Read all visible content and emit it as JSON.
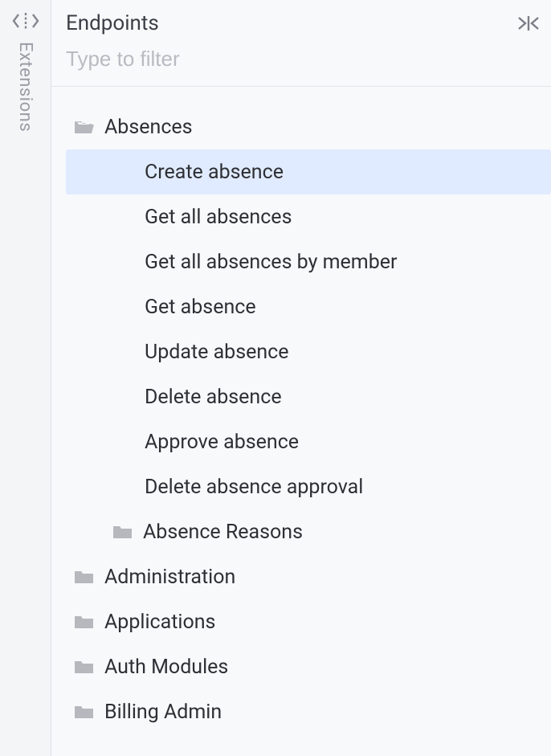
{
  "rail": {
    "label": "Extensions"
  },
  "panel": {
    "title": "Endpoints",
    "filter_placeholder": "Type to filter"
  },
  "tree": {
    "items": [
      {
        "label": "Absences",
        "type": "folder-open",
        "indent": 0,
        "selected": false
      },
      {
        "label": "Create absence",
        "type": "leaf",
        "indent": 2,
        "selected": true
      },
      {
        "label": "Get all absences",
        "type": "leaf",
        "indent": 2,
        "selected": false
      },
      {
        "label": "Get all absences by member",
        "type": "leaf",
        "indent": 2,
        "selected": false
      },
      {
        "label": "Get absence",
        "type": "leaf",
        "indent": 2,
        "selected": false
      },
      {
        "label": "Update absence",
        "type": "leaf",
        "indent": 2,
        "selected": false
      },
      {
        "label": "Delete absence",
        "type": "leaf",
        "indent": 2,
        "selected": false
      },
      {
        "label": "Approve absence",
        "type": "leaf",
        "indent": 2,
        "selected": false
      },
      {
        "label": "Delete absence approval",
        "type": "leaf",
        "indent": 2,
        "selected": false
      },
      {
        "label": "Absence Reasons",
        "type": "folder-closed",
        "indent": 1,
        "selected": false
      },
      {
        "label": "Administration",
        "type": "folder-closed",
        "indent": 0,
        "selected": false
      },
      {
        "label": "Applications",
        "type": "folder-closed",
        "indent": 0,
        "selected": false
      },
      {
        "label": "Auth Modules",
        "type": "folder-closed",
        "indent": 0,
        "selected": false
      },
      {
        "label": "Billing Admin",
        "type": "folder-closed",
        "indent": 0,
        "selected": false
      }
    ]
  }
}
